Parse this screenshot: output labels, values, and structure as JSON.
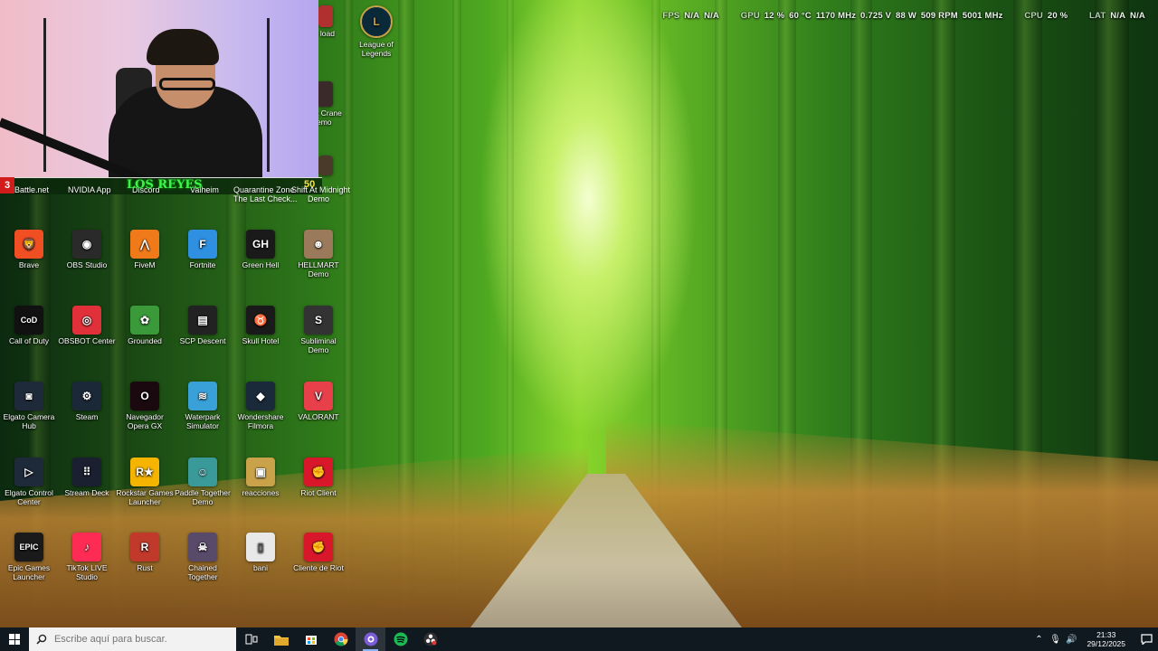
{
  "webcam": {
    "badge": "3",
    "title": "LOS REYES",
    "count": "50"
  },
  "under_labels": [
    "Battle.net",
    "NVIDIA App",
    "Discord",
    "Valheim",
    "Quarantine Zone",
    "The Last Check...",
    "Shift At Midnight",
    "Demo"
  ],
  "top_icons": {
    "partial_1": "load",
    "lol": "League of Legends",
    "crane": "t Crane",
    "crane2": "emo"
  },
  "monitor": {
    "fps_label": "FPS",
    "fps_1": "N/A",
    "fps_2": "N/A",
    "gpu_label": "GPU",
    "gpu_usage": "12 %",
    "gpu_temp": "60 °C",
    "gpu_clock": "1170 MHz",
    "gpu_volt": "0.725 V",
    "gpu_power": "88 W",
    "gpu_fan": "509 RPM",
    "gpu_mem": "5001 MHz",
    "cpu_label": "CPU",
    "cpu_usage": "20 %",
    "lat_label": "LAT",
    "lat_1": "N/A",
    "lat_2": "N/A"
  },
  "desktop_icons": [
    {
      "label": "Brave",
      "icon": "brave-icon",
      "color": "#f04e23",
      "glyph": "🦁"
    },
    {
      "label": "OBS Studio",
      "icon": "obs-icon",
      "color": "#2a2a2a",
      "glyph": "◉"
    },
    {
      "label": "FiveM",
      "icon": "fivem-icon",
      "color": "#f07a1a",
      "glyph": "⋀"
    },
    {
      "label": "Fortnite",
      "icon": "fortnite-icon",
      "color": "#2f8fe0",
      "glyph": "F"
    },
    {
      "label": "Green Hell",
      "icon": "greenhell-icon",
      "color": "#1a1a1a",
      "glyph": "GH"
    },
    {
      "label": "HELLMART Demo",
      "icon": "hellmart-icon",
      "color": "#9a7a5a",
      "glyph": "☻"
    },
    {
      "label": "Call of Duty",
      "icon": "cod-icon",
      "color": "#111111",
      "glyph": "CoD"
    },
    {
      "label": "OBSBOT Center",
      "icon": "obsbot-icon",
      "color": "#e0303a",
      "glyph": "◎"
    },
    {
      "label": "Grounded",
      "icon": "grounded-icon",
      "color": "#3a9a3a",
      "glyph": "✿"
    },
    {
      "label": "SCP Descent",
      "icon": "scp-icon",
      "color": "#222222",
      "glyph": "▤"
    },
    {
      "label": "Skull Hotel",
      "icon": "skullhotel-icon",
      "color": "#1a1a1a",
      "glyph": "♉"
    },
    {
      "label": "Subliminal Demo",
      "icon": "subliminal-icon",
      "color": "#333333",
      "glyph": "S"
    },
    {
      "label": "Elgato Camera Hub",
      "icon": "elgato-camera-icon",
      "color": "#1e2a3a",
      "glyph": "◙"
    },
    {
      "label": "Steam",
      "icon": "steam-icon",
      "color": "#1b2838",
      "glyph": "⚙"
    },
    {
      "label": "Navegador Opera GX",
      "icon": "operagx-icon",
      "color": "#1a0a10",
      "glyph": "O"
    },
    {
      "label": "Waterpark Simulator",
      "icon": "waterpark-icon",
      "color": "#3aa0d8",
      "glyph": "≋"
    },
    {
      "label": "Wondershare Filmora",
      "icon": "filmora-icon",
      "color": "#1a2a3a",
      "glyph": "◆"
    },
    {
      "label": "VALORANT",
      "icon": "valorant-icon",
      "color": "#e8404a",
      "glyph": "V"
    },
    {
      "label": "Elgato Control Center",
      "icon": "elgato-control-icon",
      "color": "#1e2a3a",
      "glyph": "▷"
    },
    {
      "label": "Stream Deck",
      "icon": "streamdeck-icon",
      "color": "#1a2030",
      "glyph": "⠿"
    },
    {
      "label": "Rockstar Games Launcher",
      "icon": "rockstar-icon",
      "color": "#f5b400",
      "glyph": "R★"
    },
    {
      "label": "Paddle Together Demo",
      "icon": "paddle-icon",
      "color": "#3a9a9a",
      "glyph": "☺"
    },
    {
      "label": "reacciones",
      "icon": "folder-icon",
      "color": "#c9a24a",
      "glyph": "▣"
    },
    {
      "label": "Riot Client",
      "icon": "riot-icon",
      "color": "#d8182a",
      "glyph": "✊"
    },
    {
      "label": "Epic Games Launcher",
      "icon": "epic-icon",
      "color": "#1a1a1a",
      "glyph": "EPIC"
    },
    {
      "label": "TikTok LIVE Studio",
      "icon": "tiktok-icon",
      "color": "#fe2c55",
      "glyph": "♪"
    },
    {
      "label": "Rust",
      "icon": "rust-icon",
      "color": "#c0392b",
      "glyph": "R"
    },
    {
      "label": "Chained Together",
      "icon": "chained-icon",
      "color": "#5a4a6a",
      "glyph": "☠"
    },
    {
      "label": "bani",
      "icon": "file-icon",
      "color": "#e8e8e8",
      "glyph": "▯"
    },
    {
      "label": "Cliente de Riot",
      "icon": "riot-client-icon",
      "color": "#d8182a",
      "glyph": "✊"
    }
  ],
  "taskbar": {
    "search_placeholder": "Escribe aquí para buscar.",
    "time": "21:33",
    "date": "29/12/2025"
  }
}
